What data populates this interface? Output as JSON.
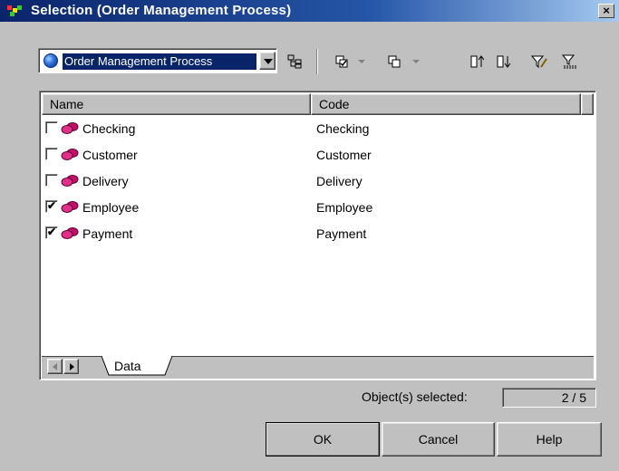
{
  "window": {
    "title": "Selection (Order Management Process)",
    "close_glyph": "×"
  },
  "toolbar": {
    "model_combo_value": "Order Management Process",
    "icons": [
      "hierarchy-icon",
      "select-all-icon",
      "deselect-all-icon",
      "move-top-icon",
      "move-bottom-icon",
      "filter-edit-icon",
      "filter-clear-icon"
    ]
  },
  "table": {
    "columns": [
      "Name",
      "Code"
    ],
    "rows": [
      {
        "name": "Checking",
        "code": "Checking",
        "checked": false
      },
      {
        "name": "Customer",
        "code": "Customer",
        "checked": false
      },
      {
        "name": "Delivery",
        "code": "Delivery",
        "checked": false
      },
      {
        "name": "Employee",
        "code": "Employee",
        "checked": true
      },
      {
        "name": "Payment",
        "code": "Payment",
        "checked": true
      }
    ]
  },
  "tabs": {
    "active": "Data"
  },
  "status": {
    "label": "Object(s) selected:",
    "count": "2 / 5"
  },
  "buttons": {
    "ok": "OK",
    "cancel": "Cancel",
    "help": "Help"
  },
  "colors": {
    "titlebar": "#0a246a",
    "selection": "#0a246a",
    "entity_icon": "#c0106a"
  }
}
